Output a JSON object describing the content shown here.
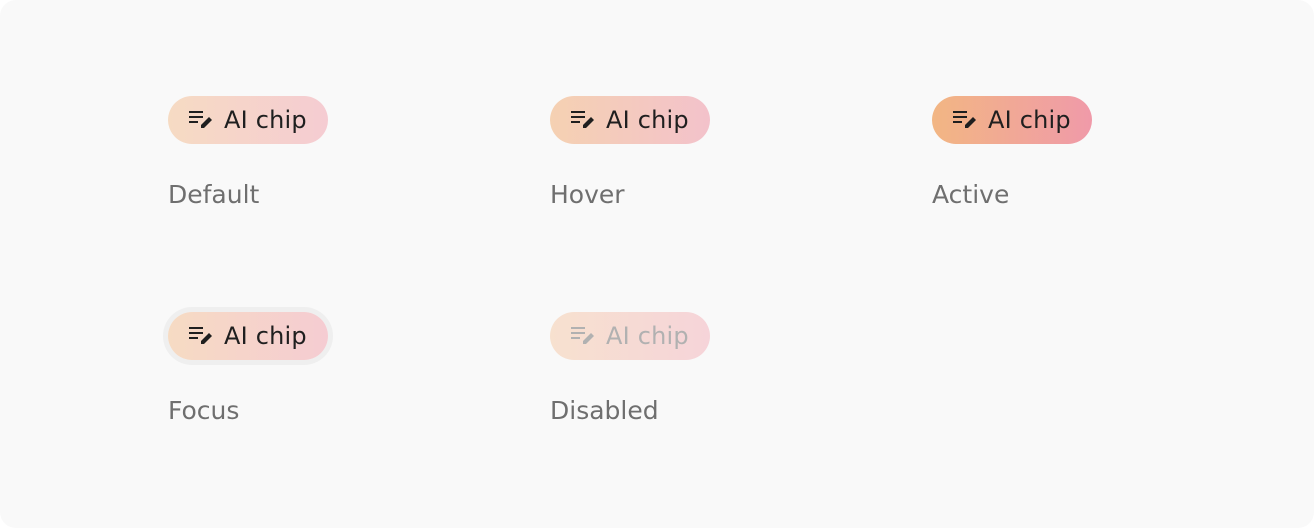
{
  "chips": [
    {
      "state": "default",
      "chip_label": "AI chip",
      "state_label": "Default",
      "icon": "edit-note-icon"
    },
    {
      "state": "hover",
      "chip_label": "AI chip",
      "state_label": "Hover",
      "icon": "edit-note-icon"
    },
    {
      "state": "active",
      "chip_label": "AI chip",
      "state_label": "Active",
      "icon": "edit-note-icon"
    },
    {
      "state": "focus",
      "chip_label": "AI chip",
      "state_label": "Focus",
      "icon": "edit-note-icon"
    },
    {
      "state": "disabled",
      "chip_label": "AI chip",
      "state_label": "Disabled",
      "icon": "edit-note-icon"
    }
  ],
  "colors": {
    "panel_bg": "#f9f9f9",
    "text": "#1f1f1f",
    "state_label": "#6f6f6f",
    "disabled_text": "#b1b1b1",
    "gradient_start": "#f6dbc3",
    "gradient_end": "#f5ccd2",
    "active_gradient_start": "#f2b683",
    "active_gradient_end": "#f09aa9"
  }
}
